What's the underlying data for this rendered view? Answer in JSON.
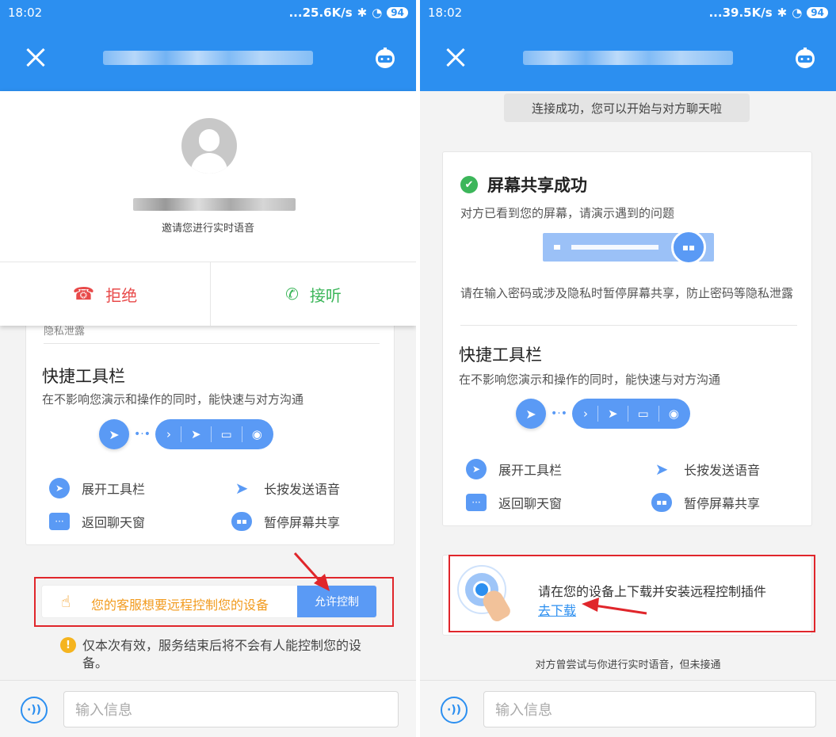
{
  "left": {
    "status": {
      "time": "18:02",
      "net": "...25.6K/s",
      "battery": "94"
    },
    "invite_text": "邀请您进行实时语音",
    "reject_label": "拒绝",
    "accept_label": "接听",
    "clipped_text": "隐私泄露",
    "toolbar_title": "快捷工具栏",
    "toolbar_desc": "在不影响您演示和操作的同时，能快速与对方沟通",
    "legend": {
      "expand": "展开工具栏",
      "voice": "长按发送语音",
      "back": "返回聊天窗",
      "pause": "暂停屏幕共享"
    },
    "remote_text": "您的客服想要远程控制您的设备",
    "allow_button": "允许控制",
    "notice": "仅本次有效，服务结束后将不会有人能控制您的设备。",
    "input_placeholder": "输入信息"
  },
  "right": {
    "status": {
      "time": "18:02",
      "net": "...39.5K/s",
      "battery": "94"
    },
    "connected_banner": "连接成功，您可以开始与对方聊天啦",
    "share_title": "屏幕共享成功",
    "share_desc": "对方已看到您的屏幕，请演示遇到的问题",
    "privacy_tip": "请在输入密码或涉及隐私时暂停屏幕共享，防止密码等隐私泄露",
    "toolbar_title": "快捷工具栏",
    "toolbar_desc": "在不影响您演示和操作的同时，能快速与对方沟通",
    "legend": {
      "expand": "展开工具栏",
      "voice": "长按发送语音",
      "back": "返回聊天窗",
      "pause": "暂停屏幕共享"
    },
    "plugin_text": "请在您的设备上下载并安装远程控制插件",
    "download_link": "去下载",
    "voice_note": "对方曾尝试与你进行实时语音，但未接通",
    "input_placeholder": "输入信息"
  },
  "colors": {
    "primary": "#2c8ff0",
    "accent": "#5a9af5",
    "reject": "#e84a4a",
    "accept": "#3cb65a",
    "orange": "#f29b1f",
    "highlight": "#e0262b"
  }
}
